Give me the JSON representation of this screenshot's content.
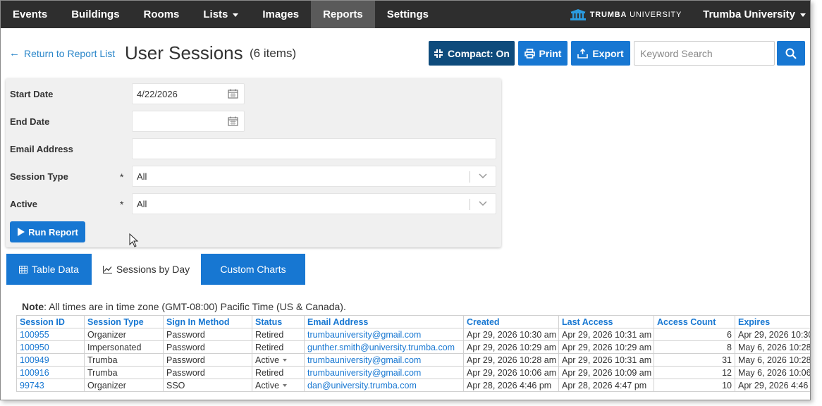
{
  "nav": {
    "items": [
      {
        "label": "Events",
        "dropdown": false,
        "active": false
      },
      {
        "label": "Buildings",
        "dropdown": false,
        "active": false
      },
      {
        "label": "Rooms",
        "dropdown": false,
        "active": false
      },
      {
        "label": "Lists",
        "dropdown": true,
        "active": false
      },
      {
        "label": "Images",
        "dropdown": false,
        "active": false
      },
      {
        "label": "Reports",
        "dropdown": false,
        "active": true
      },
      {
        "label": "Settings",
        "dropdown": false,
        "active": false
      }
    ],
    "logo_bold": "TRUMBA",
    "logo_light": "UNIVERSITY",
    "account": "Trumba University"
  },
  "header": {
    "back_label": "Return to Report List",
    "title": "User Sessions",
    "count": "(6 items)",
    "compact_label": "Compact: On",
    "print_label": "Print",
    "export_label": "Export",
    "search_placeholder": "Keyword Search"
  },
  "filters": {
    "start_date": {
      "label": "Start Date",
      "value": "4/22/2026"
    },
    "end_date": {
      "label": "End Date",
      "value": ""
    },
    "email": {
      "label": "Email Address",
      "value": ""
    },
    "session_type": {
      "label": "Session Type",
      "required": "*",
      "value": "All"
    },
    "active": {
      "label": "Active",
      "required": "*",
      "value": "All"
    },
    "run_label": "Run Report"
  },
  "tabs": {
    "table": "Table Data",
    "sessions": "Sessions by Day",
    "custom": "Custom Charts"
  },
  "note": {
    "bold": "Note",
    "text": ": All times are in time zone (GMT-08:00) Pacific Time (US & Canada)."
  },
  "table": {
    "columns": [
      "Session ID",
      "Session Type",
      "Sign In Method",
      "Status",
      "Email Address",
      "Created",
      "Last Access",
      "Access Count",
      "Expires"
    ],
    "rows": [
      {
        "id": "100955",
        "type": "Organizer",
        "method": "Password",
        "status": "Retired",
        "status_menu": false,
        "email": "trumbauniversity@gmail.com",
        "created": "Apr 29, 2026 10:30 am",
        "last": "Apr 29, 2026 10:31 am",
        "count": "6",
        "expires": "Apr 29, 2026 10:30"
      },
      {
        "id": "100950",
        "type": "Impersonated",
        "method": "Password",
        "status": "Retired",
        "status_menu": false,
        "email": "gunther.smith@university.trumba.com",
        "created": "Apr 29, 2026 10:29 am",
        "last": "Apr 29, 2026 10:29 am",
        "count": "8",
        "expires": "May 6, 2026 10:28"
      },
      {
        "id": "100949",
        "type": "Trumba",
        "method": "Password",
        "status": "Active",
        "status_menu": true,
        "email": "trumbauniversity@gmail.com",
        "created": "Apr 29, 2026 10:28 am",
        "last": "Apr 29, 2026 10:31 am",
        "count": "31",
        "expires": "May 6, 2026 10:28"
      },
      {
        "id": "100916",
        "type": "Trumba",
        "method": "Password",
        "status": "Retired",
        "status_menu": false,
        "email": "trumbauniversity@gmail.com",
        "created": "Apr 29, 2026 10:06 am",
        "last": "Apr 29, 2026 10:09 am",
        "count": "12",
        "expires": "May 6, 2026 10:06"
      },
      {
        "id": "99743",
        "type": "Organizer",
        "method": "SSO",
        "status": "Active",
        "status_menu": true,
        "email": "dan@university.trumba.com",
        "created": "Apr 28, 2026 4:46 pm",
        "last": "Apr 28, 2026 4:47 pm",
        "count": "10",
        "expires": "Apr 29, 2026 4:46"
      }
    ]
  },
  "colors": {
    "nav_bg": "#2e2e2e",
    "primary": "#1777d2",
    "compact": "#0e4b7c",
    "link": "#2a86c9"
  }
}
